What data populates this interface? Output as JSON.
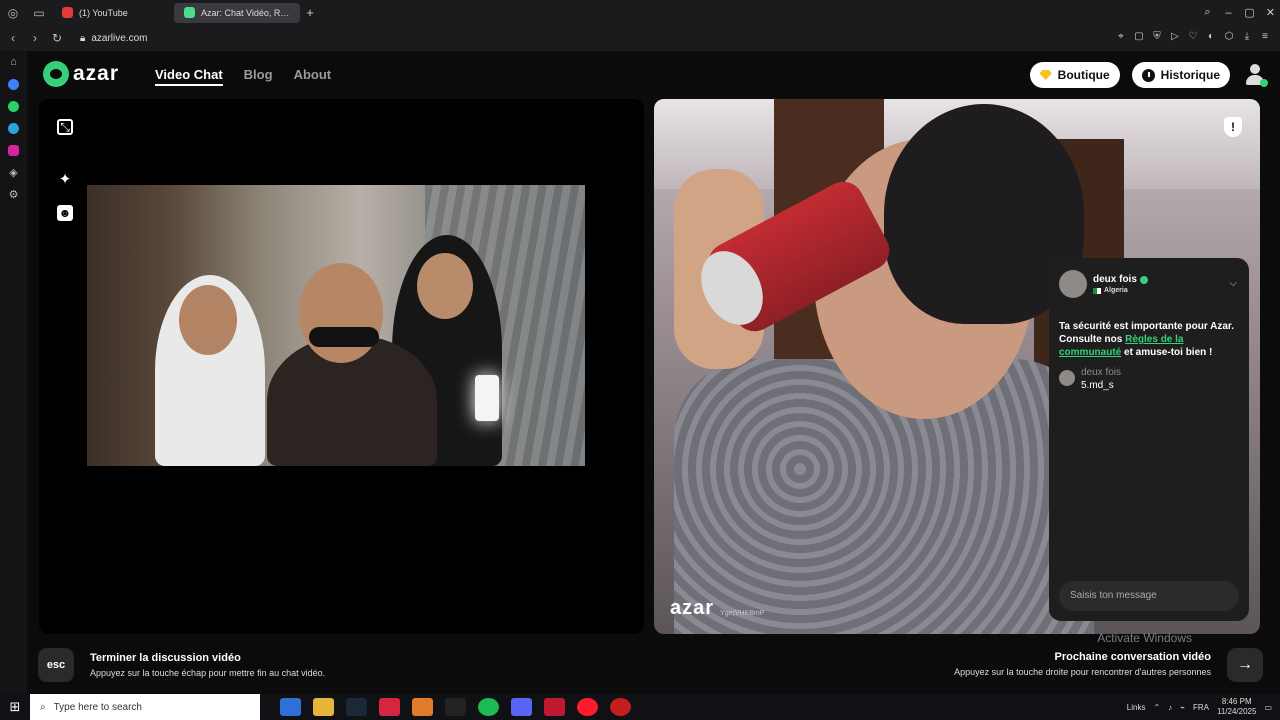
{
  "browser": {
    "tabs": [
      {
        "label": "(1) YouTube",
        "active": false,
        "icon": "youtube-icon"
      },
      {
        "label": "Azar: Chat Vidéo, Rencontrez",
        "active": true,
        "icon": "azar-icon"
      }
    ],
    "url": "azarlive.com",
    "new_tab": "+"
  },
  "site": {
    "logo_text": "azar",
    "nav": [
      {
        "label": "Video Chat",
        "active": true
      },
      {
        "label": "Blog",
        "active": false
      },
      {
        "label": "About",
        "active": false
      }
    ],
    "shop_label": "Boutique",
    "history_label": "Historique",
    "accent": "#35d17a"
  },
  "remote": {
    "logo_text": "azar",
    "user_id": "Yge(VHKBmP"
  },
  "chat": {
    "partner_name": "deux fois",
    "partner_country": "Algeria",
    "safety_before": "Ta sécurité est importante pour Azar. Consulte nos ",
    "safety_link": "Règles de la communauté",
    "safety_after": " et amuse-toi bien !",
    "message_author": "deux fois",
    "message_text": "5.md_s",
    "input_placeholder": "Saisis ton message"
  },
  "hints": {
    "esc_key": "esc",
    "end_title": "Terminer la discussion vidéo",
    "end_sub": "Appuyez sur la touche échap pour mettre fin au chat vidéo.",
    "next_title": "Prochaine conversation vidéo",
    "next_sub": "Appuyez sur la touche droite pour rencontrer d'autres personnes",
    "next_key": "→"
  },
  "watermark": "Activate Windows",
  "taskbar": {
    "search_placeholder": "Type here to search",
    "tray_links": "Links",
    "language": "FRA",
    "time": "8:46 PM",
    "date": "11/24/2025"
  }
}
